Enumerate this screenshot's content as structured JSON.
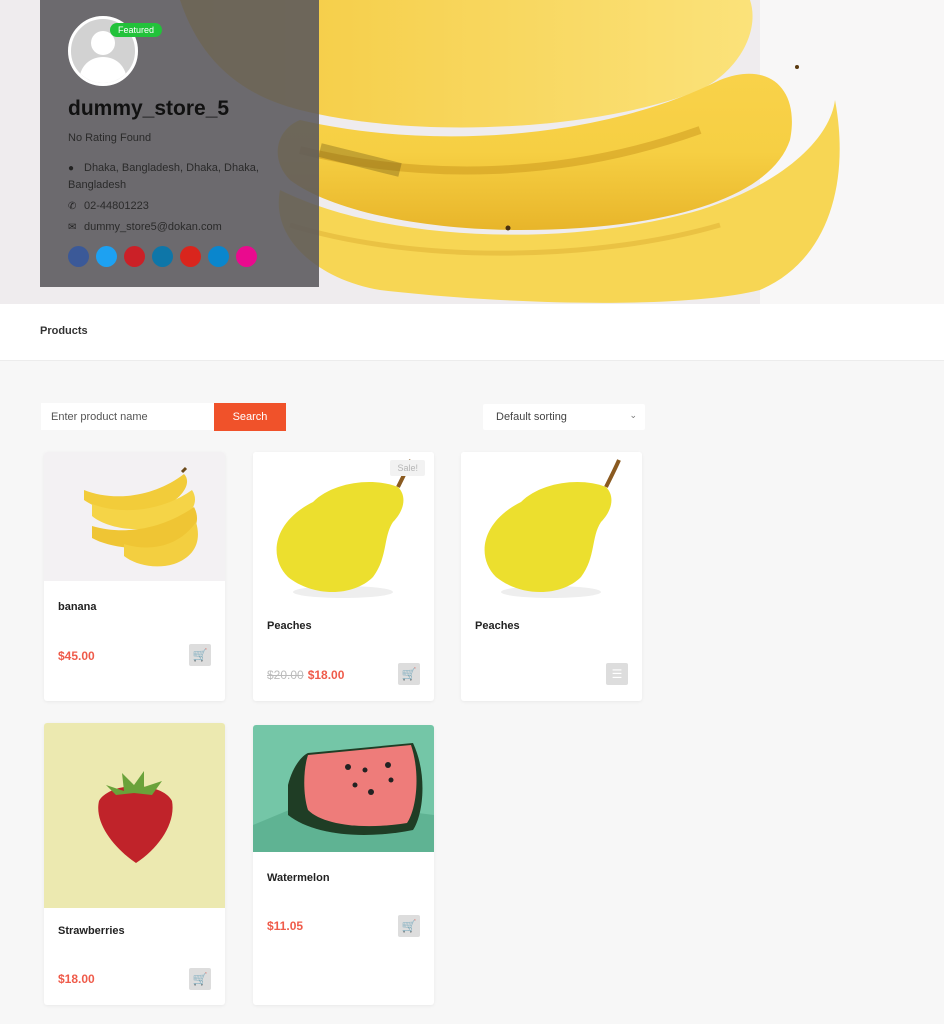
{
  "store": {
    "name": "dummy_store_5",
    "featured_badge": "Featured",
    "rating": "No Rating Found",
    "address": "Dhaka, Bangladesh, Dhaka, Dhaka, Bangladesh",
    "phone": "02-44801223",
    "email": "dummy_store5@dokan.com",
    "icons": {
      "address": "map-marker-icon",
      "phone": "phone-icon",
      "email": "envelope-icon"
    },
    "socials": [
      {
        "name": "facebook",
        "color": "#3b5998"
      },
      {
        "name": "twitter",
        "color": "#1da1f2"
      },
      {
        "name": "pinterest",
        "color": "#cb2027"
      },
      {
        "name": "linkedin",
        "color": "#0e76a8"
      },
      {
        "name": "youtube",
        "color": "#d9251d"
      },
      {
        "name": "flickr-or-skype",
        "color": "#0a86cd"
      },
      {
        "name": "dribbble",
        "color": "#ea0a8e"
      }
    ]
  },
  "tabs": [
    {
      "label": "Products",
      "active": true
    }
  ],
  "search": {
    "placeholder": "Enter product name",
    "value": "",
    "button_label": "Search"
  },
  "sort": {
    "selected": "Default sorting"
  },
  "products": [
    {
      "title": "banana",
      "price": "$45.00",
      "old_price": null,
      "sale": false,
      "action": "add-to-cart",
      "image": "banana"
    },
    {
      "title": "Peaches",
      "price": "$18.00",
      "old_price": "$20.00",
      "sale": true,
      "sale_label": "Sale!",
      "action": "add-to-cart",
      "image": "pear"
    },
    {
      "title": "Peaches",
      "price": null,
      "old_price": null,
      "sale": false,
      "action": "select-options",
      "image": "pear"
    },
    {
      "title": "Strawberries",
      "price": "$18.00",
      "old_price": null,
      "sale": false,
      "action": "add-to-cart",
      "image": "strawberry"
    },
    {
      "title": "Watermelon",
      "price": "$11.05",
      "old_price": null,
      "sale": false,
      "action": "add-to-cart",
      "image": "watermelon"
    }
  ],
  "colors": {
    "accent": "#f0522a",
    "price": "#ef5b4a",
    "featured": "#22c23a"
  }
}
